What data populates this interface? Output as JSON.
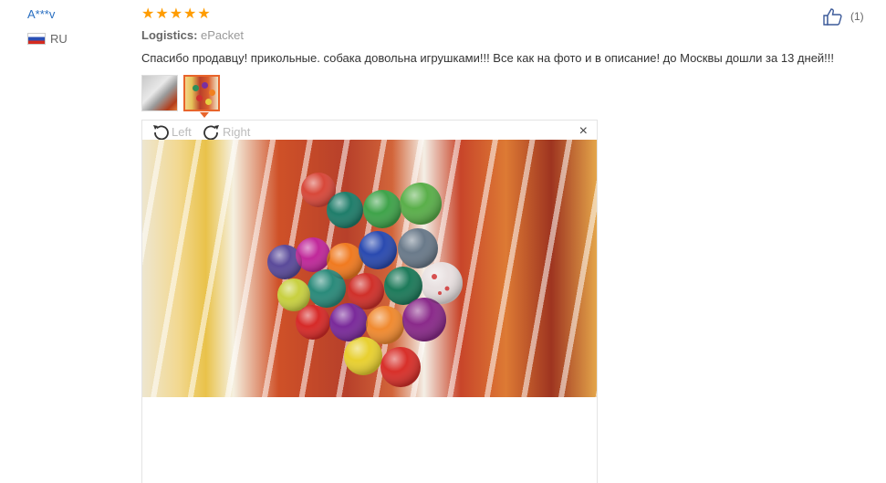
{
  "review": {
    "user_name": "A***v",
    "country_code": "RU",
    "stars": [
      "★",
      "★",
      "★",
      "★",
      "★"
    ],
    "logistics_label": "Logistics:",
    "logistics_value": "ePacket",
    "text": "Спасибо продавцу! прикольные. собака довольна игрушками!!! Все как на фото и в описание! до Москвы дошли за 13 дней!!!",
    "helpful_count": "(1)"
  },
  "viewer": {
    "rotate_left_label": "Left",
    "rotate_right_label": "Right",
    "close_glyph": "×"
  },
  "colors": {
    "username": "#2a6fc1",
    "star": "#ff9c00",
    "active_thumb": "#e8642b"
  },
  "icons": {
    "helpful": "thumbs-up-icon",
    "rotate_left": "rotate-left-icon",
    "rotate_right": "rotate-right-icon",
    "close": "close-icon"
  }
}
